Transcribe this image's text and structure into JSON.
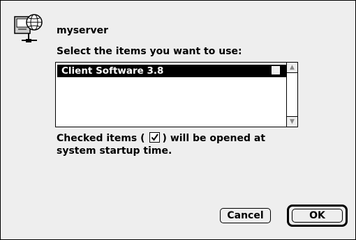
{
  "dialog": {
    "server_name": "myserver",
    "prompt": "Select the items you want to use:",
    "list_items": [
      {
        "label": "Client Software 3.8",
        "selected": true,
        "checked": false
      }
    ],
    "info_line1_before": "Checked items (",
    "info_line1_after": ") will be opened at",
    "info_line2": "system startup time.",
    "cancel_label": "Cancel",
    "ok_label": "OK"
  },
  "icons": {
    "server": "server-globe-icon",
    "checkbox": "checkbox-icon",
    "check_sample": "checkmark-icon",
    "scroll_up": "scroll-up-arrow-icon",
    "scroll_down": "scroll-down-arrow-icon"
  },
  "colors": {
    "dialog_bg": "#eeeeee",
    "selection_bg": "#000000",
    "selection_text": "#ffffff"
  }
}
